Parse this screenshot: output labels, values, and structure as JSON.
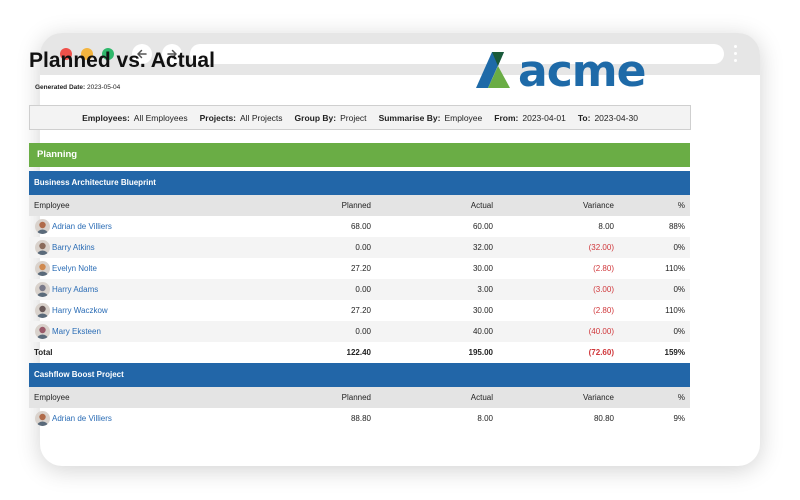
{
  "report": {
    "title": "Planned vs. Actual",
    "generated_label": "Generated Date:",
    "generated_value": "2023-05-04",
    "logo_text": "acme"
  },
  "filters": [
    {
      "label": "Employees:",
      "value": "All Employees"
    },
    {
      "label": "Projects:",
      "value": "All Projects"
    },
    {
      "label": "Group By:",
      "value": "Project"
    },
    {
      "label": "Summarise By:",
      "value": "Employee"
    },
    {
      "label": "From:",
      "value": "2023-04-01"
    },
    {
      "label": "To:",
      "value": "2023-04-30"
    }
  ],
  "section": "Planning",
  "columns": {
    "employee": "Employee",
    "planned": "Planned",
    "actual": "Actual",
    "variance": "Variance",
    "pct": "%"
  },
  "projects": [
    {
      "name": "Business Architecture Blueprint",
      "rows": [
        {
          "employee": "Adrian de Villiers",
          "planned": "68.00",
          "actual": "60.00",
          "variance": "8.00",
          "pct": "88%"
        },
        {
          "employee": "Barry Atkins",
          "planned": "0.00",
          "actual": "32.00",
          "variance": "(32.00)",
          "pct": "0%"
        },
        {
          "employee": "Evelyn Nolte",
          "planned": "27.20",
          "actual": "30.00",
          "variance": "(2.80)",
          "pct": "110%"
        },
        {
          "employee": "Harry Adams",
          "planned": "0.00",
          "actual": "3.00",
          "variance": "(3.00)",
          "pct": "0%"
        },
        {
          "employee": "Harry Waczkow",
          "planned": "27.20",
          "actual": "30.00",
          "variance": "(2.80)",
          "pct": "110%"
        },
        {
          "employee": "Mary Eksteen",
          "planned": "0.00",
          "actual": "40.00",
          "variance": "(40.00)",
          "pct": "0%"
        }
      ],
      "total": {
        "label": "Total",
        "planned": "122.40",
        "actual": "195.00",
        "variance": "(72.60)",
        "pct": "159%"
      }
    },
    {
      "name": "Cashflow Boost Project",
      "rows": [
        {
          "employee": "Adrian de Villiers",
          "planned": "88.80",
          "actual": "8.00",
          "variance": "80.80",
          "pct": "9%"
        }
      ]
    }
  ],
  "colors": {
    "green_header": "#6aad45",
    "blue_header": "#2266a8",
    "negative": "#d0373b",
    "link": "#2a6cb5"
  },
  "icons": [
    "back-arrow-icon",
    "forward-arrow-icon",
    "kebab-menu-icon",
    "avatar"
  ]
}
